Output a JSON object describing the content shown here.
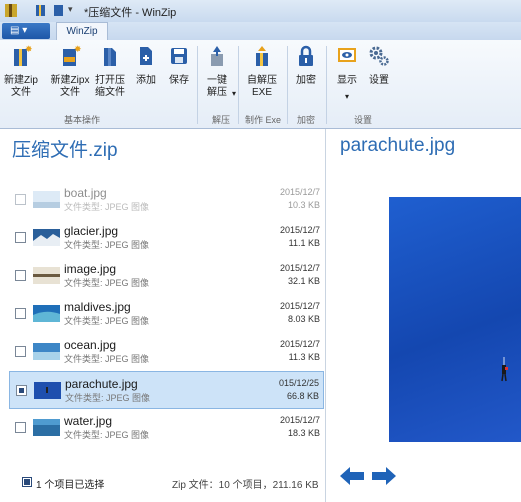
{
  "window": {
    "title": "*压缩文件 - WinZip"
  },
  "tabs": {
    "file_menu": "",
    "active": "WinZip"
  },
  "ribbon": {
    "buttons": [
      {
        "label": "新建Zip\n文件",
        "icon": "new-zip-icon"
      },
      {
        "label": "新建Zipx\n文件",
        "icon": "new-zipx-icon"
      },
      {
        "label": "打开压\n缩文件",
        "icon": "open-archive-icon"
      },
      {
        "label": "添加",
        "icon": "add-file-icon"
      },
      {
        "label": "保存",
        "icon": "save-icon"
      },
      {
        "label": "一键\n解压",
        "icon": "unzip-icon"
      },
      {
        "label": "自解压\nEXE",
        "icon": "self-extract-icon"
      },
      {
        "label": "加密",
        "icon": "lock-icon"
      },
      {
        "label": "显示",
        "icon": "display-icon"
      },
      {
        "label": "设置",
        "icon": "settings-icon"
      }
    ],
    "groups": {
      "basic": "基本操作",
      "unzip": "解压",
      "exe": "制作 Exe",
      "encrypt": "加密",
      "settings": "设置"
    }
  },
  "archive": {
    "title": "压缩文件.zip",
    "files": [
      {
        "name": "boat.jpg",
        "type": "文件类型: JPEG 图像",
        "date": "2015/12/7",
        "size": "10.3 KB",
        "checked": false
      },
      {
        "name": "glacier.jpg",
        "type": "文件类型: JPEG 图像",
        "date": "2015/12/7",
        "size": "11.1 KB",
        "checked": false
      },
      {
        "name": "image.jpg",
        "type": "文件类型: JPEG 图像",
        "date": "2015/12/7",
        "size": "32.1 KB",
        "checked": false
      },
      {
        "name": "maldives.jpg",
        "type": "文件类型: JPEG 图像",
        "date": "2015/12/7",
        "size": "8.03 KB",
        "checked": false
      },
      {
        "name": "ocean.jpg",
        "type": "文件类型: JPEG 图像",
        "date": "2015/12/7",
        "size": "11.3 KB",
        "checked": false
      },
      {
        "name": "parachute.jpg",
        "type": "文件类型: JPEG 图像",
        "date": "015/12/25",
        "size": "66.8 KB",
        "checked": true
      },
      {
        "name": "water.jpg",
        "type": "文件类型: JPEG 图像",
        "date": "2015/12/7",
        "size": "18.3 KB",
        "checked": false
      }
    ],
    "status_selected": "1 个项目已选择",
    "status_summary": "Zip 文件：10 个项目，211.16 KB"
  },
  "preview": {
    "title": "parachute.jpg"
  },
  "colors": {
    "accent": "#2e6db4",
    "selection": "#cde3f8",
    "preview_sky": "#1f5fd0"
  }
}
